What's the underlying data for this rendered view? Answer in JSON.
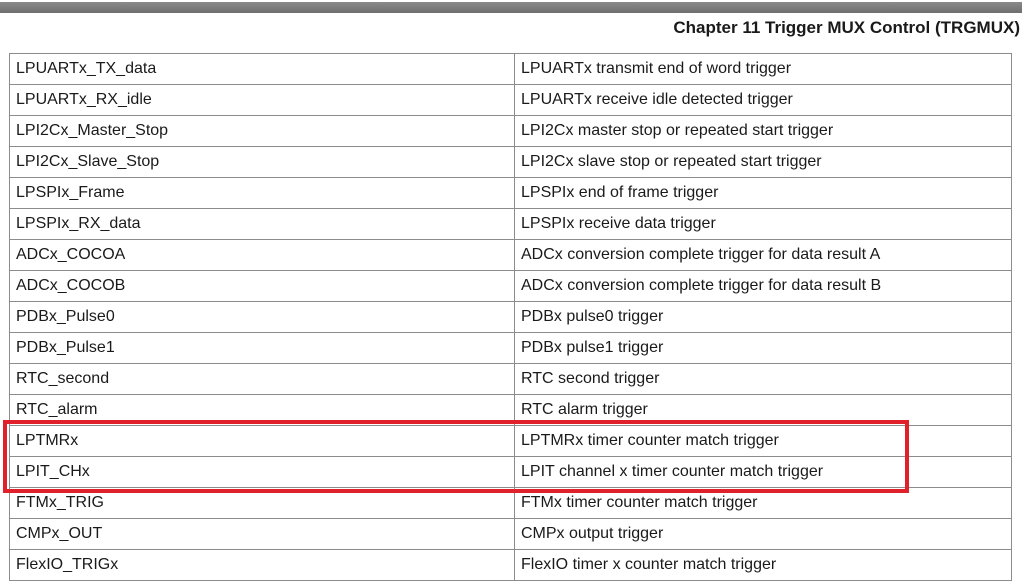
{
  "header": {
    "chapter_title": "Chapter 11 Trigger MUX Control (TRGMUX)"
  },
  "highlight": {
    "color": "#e0202a",
    "rows": [
      12,
      13
    ]
  },
  "table": {
    "rows": [
      {
        "signal": "LPUARTx_TX_data",
        "description": "LPUARTx transmit end of word trigger"
      },
      {
        "signal": "LPUARTx_RX_idle",
        "description": "LPUARTx receive idle detected trigger"
      },
      {
        "signal": "LPI2Cx_Master_Stop",
        "description": "LPI2Cx master stop or repeated start trigger"
      },
      {
        "signal": "LPI2Cx_Slave_Stop",
        "description": "LPI2Cx slave stop or repeated start trigger"
      },
      {
        "signal": "LPSPIx_Frame",
        "description": "LPSPIx end of frame trigger"
      },
      {
        "signal": "LPSPIx_RX_data",
        "description": "LPSPIx receive data trigger"
      },
      {
        "signal": "ADCx_COCOA",
        "description": "ADCx conversion complete trigger for data result A"
      },
      {
        "signal": "ADCx_COCOB",
        "description": "ADCx conversion complete trigger for data result B"
      },
      {
        "signal": "PDBx_Pulse0",
        "description": "PDBx pulse0 trigger"
      },
      {
        "signal": "PDBx_Pulse1",
        "description": "PDBx pulse1 trigger"
      },
      {
        "signal": "RTC_second",
        "description": "RTC second trigger"
      },
      {
        "signal": "RTC_alarm",
        "description": "RTC alarm trigger"
      },
      {
        "signal": "LPTMRx",
        "description": "LPTMRx timer counter match trigger"
      },
      {
        "signal": "LPIT_CHx",
        "description": "LPIT channel x timer counter match trigger"
      },
      {
        "signal": "FTMx_TRIG",
        "description": "FTMx timer counter match trigger"
      },
      {
        "signal": "CMPx_OUT",
        "description": "CMPx output trigger"
      },
      {
        "signal": "FlexIO_TRIGx",
        "description": "FlexIO timer x counter match trigger"
      }
    ]
  }
}
